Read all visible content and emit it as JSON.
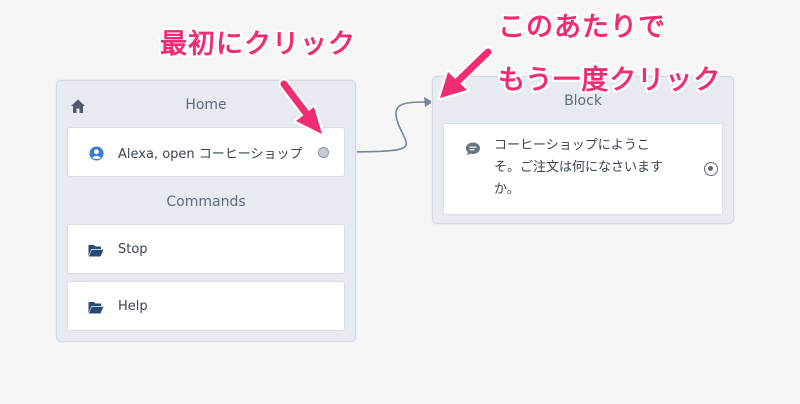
{
  "home_panel": {
    "title": "Home",
    "launch_card": {
      "label": "Alexa, open コーヒーショップ",
      "icon": "user-circle-icon"
    },
    "commands_title": "Commands",
    "commands": [
      {
        "label": "Stop",
        "icon": "folder-open-icon"
      },
      {
        "label": "Help",
        "icon": "folder-open-icon"
      }
    ]
  },
  "block_panel": {
    "title": "Block",
    "speech_text_line1": "コーヒーショップにようこ",
    "speech_text_line2": "そ。ご注文は何になさいます",
    "speech_text_line3": "か。",
    "icon": "speech-bubble-icon"
  },
  "annotations": {
    "first_click": "最初にクリック",
    "second_click_line1": "このあたりで",
    "second_click_line2": "もう一度クリック"
  },
  "colors": {
    "accent_pink": "#f02c72",
    "panel_bg": "#e7eaf0",
    "connector": "#7a8699",
    "user_icon_blue": "#3d7bd9",
    "folder_icon_navy": "#2b4a73"
  }
}
